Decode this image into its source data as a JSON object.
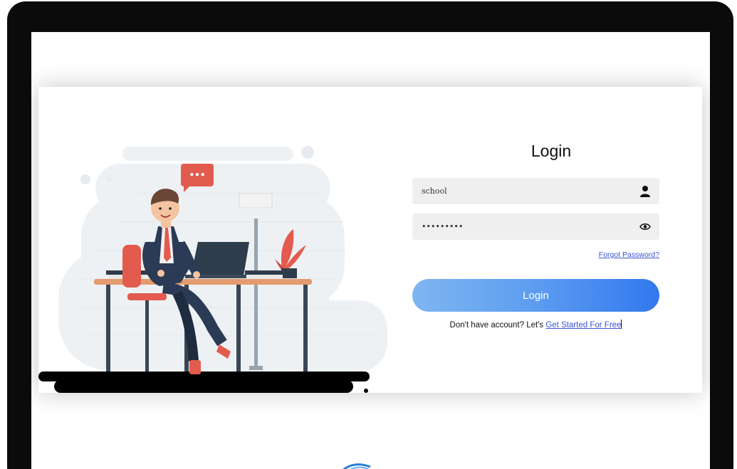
{
  "login": {
    "title": "Login",
    "username_value": "school",
    "password_value": "•••••••••",
    "forgot_label": "Forgot Password?",
    "button_label": "Login",
    "signup_prompt": "Don't have account? Let's ",
    "signup_link": "Get Started For Free"
  },
  "illustration": {
    "speech_bubble": "•••"
  },
  "icons": {
    "username": "user-icon",
    "password": "eye-icon"
  },
  "colors": {
    "button_gradient_start": "#7fb6f1",
    "button_gradient_end": "#3278ee",
    "link": "#3b55d8",
    "field_bg": "#efefef"
  }
}
